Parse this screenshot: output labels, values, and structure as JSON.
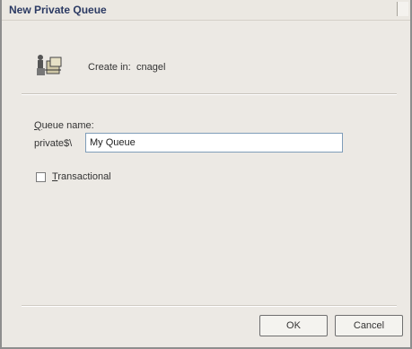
{
  "window": {
    "title": "New Private Queue"
  },
  "header": {
    "create_label": "Create in:",
    "create_value": "cnagel"
  },
  "form": {
    "queue_name_label": "Queue name:",
    "queue_name_accel": "Q",
    "queue_name_rest": "ueue name:",
    "prefix": "private$\\",
    "queue_name_value": "My Queue",
    "transactional_label": "Transactional",
    "transactional_accel": "T",
    "transactional_rest": "ransactional",
    "transactional_checked": false
  },
  "buttons": {
    "ok": "OK",
    "cancel": "Cancel"
  },
  "icons": {
    "queue": "queue-icon"
  }
}
